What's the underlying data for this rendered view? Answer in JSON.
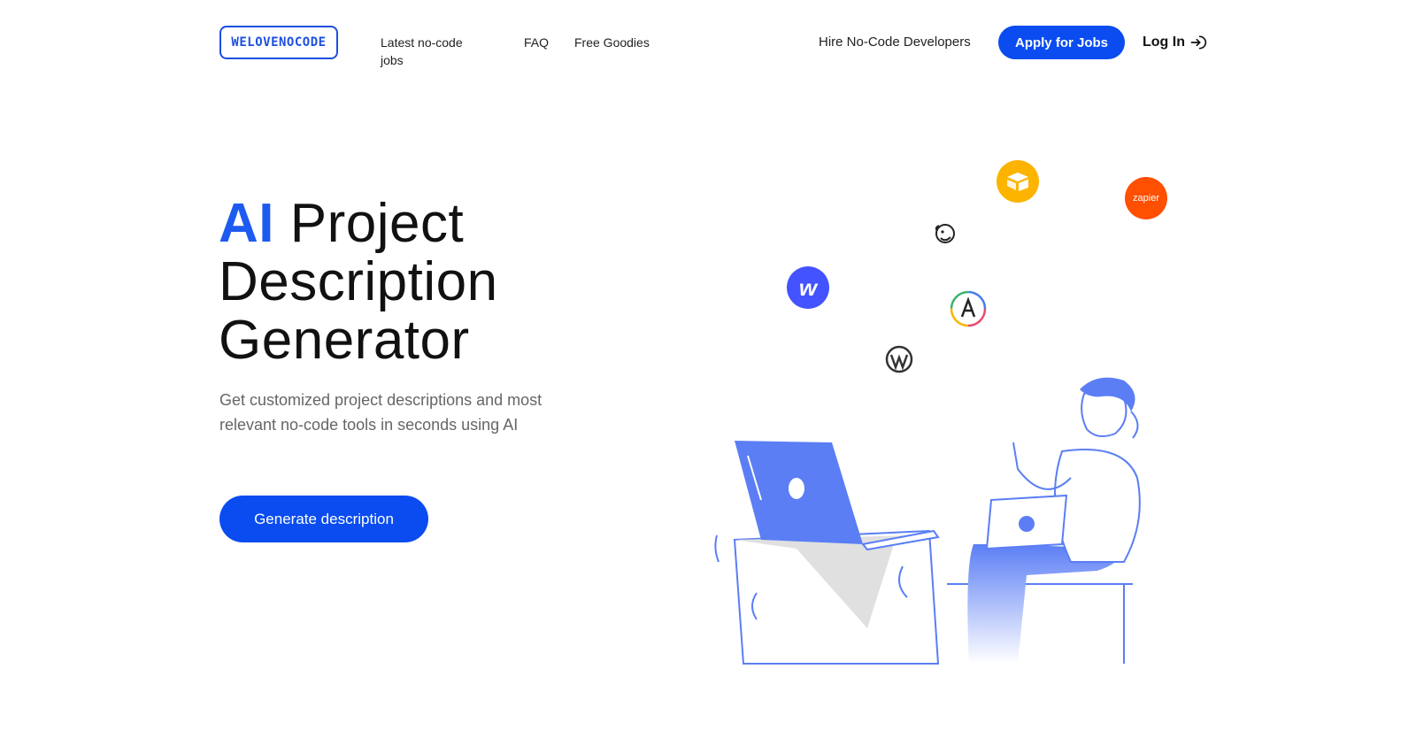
{
  "header": {
    "logo_text": "WELOVENOCODE",
    "nav": {
      "latest_jobs": "Latest no-code jobs",
      "faq": "FAQ",
      "free_goodies": "Free Goodies",
      "hire": "Hire No-Code Developers"
    },
    "apply_label": "Apply for Jobs",
    "login_label": "Log In"
  },
  "hero": {
    "title_accent": "AI",
    "title_rest": "Project Description Generator",
    "subtitle": "Get customized project descriptions and most relevant no-code tools in seconds using AI",
    "cta_label": "Generate description"
  },
  "illustration": {
    "tool_icons": [
      "webflow-icon",
      "airtable-icon",
      "zapier-icon",
      "mailchimp-icon",
      "adalo-icon",
      "wordpress-icon"
    ],
    "zapier_text": "zapier",
    "webflow_text": "w"
  },
  "colors": {
    "accent": "#0a4cf0",
    "title_accent": "#1d5bf0",
    "illustration_blue": "#5b7ef5"
  }
}
